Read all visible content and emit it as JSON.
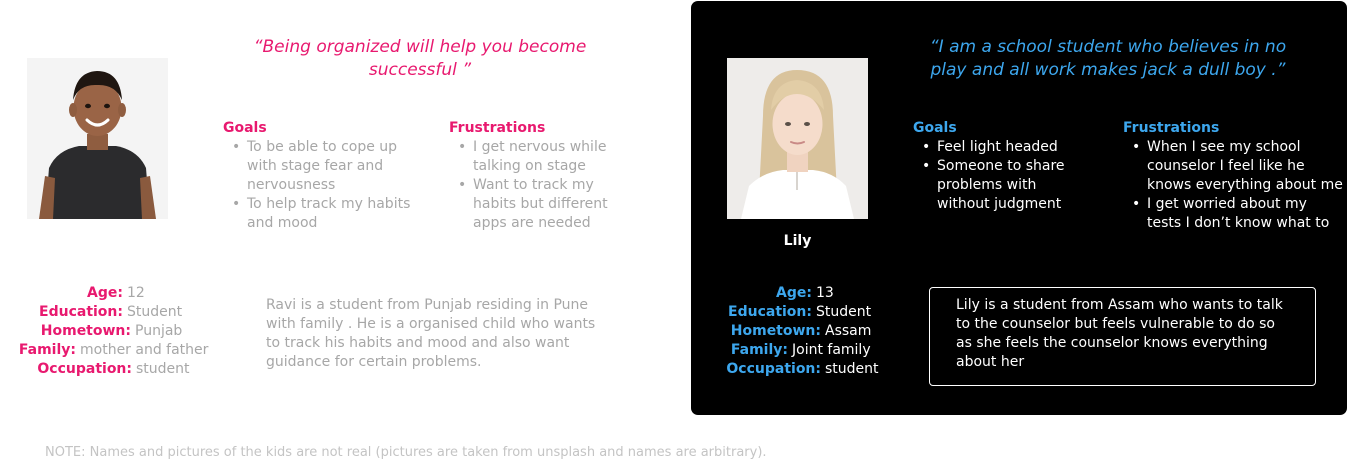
{
  "persona_ravi": {
    "quote": "“Being organized will help you become successful ”",
    "goals_title": "Goals",
    "goals": [
      "To be able to cope up with stage fear and nervousness",
      "To help track my habits and mood"
    ],
    "frustrations_title": "Frustrations",
    "frustrations": [
      "I get nervous while talking on stage",
      "Want to track my habits but different apps are needed"
    ],
    "facts": {
      "age_label": "Age:",
      "age": "12",
      "education_label": "Education:",
      "education": "Student",
      "hometown_label": "Hometown:",
      "hometown": "Punjab",
      "family_label": "Family:",
      "family": "mother and father",
      "occupation_label": "Occupation:",
      "occupation": "student"
    },
    "bio": "Ravi is a student from Punjab residing in Pune with family . He is a organised child who wants to track his habits and mood and also want guidance for certain problems."
  },
  "persona_lily": {
    "quote": "“I am a school student who believes in no play and all work makes jack a dull boy .”",
    "name": "Lily",
    "goals_title": "Goals",
    "goals": [
      "Feel light headed",
      "Someone to share problems with without judgment"
    ],
    "frustrations_title": "Frustrations",
    "frustrations": [
      "When I see my school counselor I feel like he knows everything about me",
      "I get worried about my tests I don’t know what to"
    ],
    "facts": {
      "age_label": "Age:",
      "age": "13",
      "education_label": "Education:",
      "education": "Student",
      "hometown_label": "Hometown:",
      "hometown": "Assam",
      "family_label": "Family:",
      "family": "Joint family",
      "occupation_label": "Occupation:",
      "occupation": "student"
    },
    "bio": "Lily is a student from Assam who wants to talk to the counselor but feels vulnerable to do so as she feels the counselor knows everything about her"
  },
  "note": "NOTE: Names and pictures of the kids are not real (pictures are taken from unsplash and names are arbitrary).",
  "colors": {
    "ravi_accent": "#e8196f",
    "lily_accent": "#3da7ee",
    "muted_text": "#a7a7a7",
    "dark_card": "#000000"
  }
}
